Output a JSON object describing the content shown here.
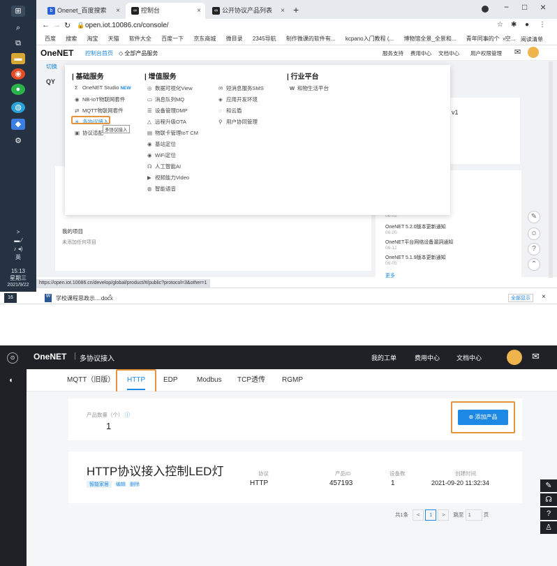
{
  "screenshot1": {
    "taskbar": {
      "time": "15:13",
      "weekday": "星期三",
      "date": "2021/9/22",
      "ime": "英",
      "notify_count": "16"
    },
    "tabs": [
      {
        "label": "Onenet_百度搜索",
        "close": "×"
      },
      {
        "label": "控制台",
        "close": "×"
      },
      {
        "label": "公开协议产品列表",
        "close": "×"
      }
    ],
    "new_tab": "+",
    "window_controls": {
      "minimize": "−",
      "maximize": "□",
      "close": "×"
    },
    "address": "open.iot.10086.cn/console/",
    "bookmarks": [
      "百度",
      "搜索",
      "淘宝",
      "天猫",
      "软件大全",
      "百度一下",
      "京东商城",
      "微目录",
      "2345导航",
      "制作微课的软件有...",
      "kcpano入门教程 (...",
      "博物馆全景_全景和...",
      "青年同事的个人空..."
    ],
    "bookmarks_more": "»",
    "reading_list": "阅读清单",
    "header": {
      "logo": "OneNET",
      "console_home": "控制台首页",
      "all_services": "全部产品服务",
      "nav": [
        "服务支持",
        "费用中心",
        "文档中心",
        "用户权限管理"
      ]
    },
    "mega_menu": {
      "columns": [
        {
          "title": "基础服务",
          "items": [
            {
              "icon": "Σ",
              "label": "OneNET Studio",
              "badge": "NEW"
            },
            {
              "icon": "◉",
              "label": "NB-IoT物联网套件"
            },
            {
              "icon": "⇄",
              "label": "MQTT物联网套件"
            },
            {
              "icon": "✳",
              "label": "多协议接入"
            },
            {
              "icon": "▣",
              "label": "协议适配"
            }
          ]
        },
        {
          "title": "增值服务",
          "items": [
            {
              "icon": "◎",
              "label": "数据可视化View"
            },
            {
              "icon": "▭",
              "label": "消息队列MQ"
            },
            {
              "icon": "☰",
              "label": "设备管理DMP"
            },
            {
              "icon": "△",
              "label": "远程升级OTA"
            },
            {
              "icon": "▤",
              "label": "物联卡管理IoT CM"
            },
            {
              "icon": "◉",
              "label": "基站定位"
            },
            {
              "icon": "◉",
              "label": "WiFi定位"
            },
            {
              "icon": "☊",
              "label": "人工智能AI"
            },
            {
              "icon": "▶",
              "label": "视频能力Video"
            },
            {
              "icon": "◍",
              "label": "智能语音"
            }
          ]
        },
        {
          "title": "",
          "items": [
            {
              "icon": "✉",
              "label": "短消息服务SMS"
            },
            {
              "icon": "◈",
              "label": "应用开发环境"
            },
            {
              "icon": "◌",
              "label": "和云盾"
            },
            {
              "icon": "⚲",
              "label": "用户协同管理"
            }
          ]
        },
        {
          "title": "行业平台",
          "items": [
            {
              "icon": "W",
              "label": "和物生活平台"
            }
          ]
        }
      ],
      "tooltip": "多协议接入"
    },
    "background": {
      "partial_text_1": "切换",
      "partial_text_2": "QY",
      "partial_text_3": "v1",
      "my_projects": "我的项目",
      "no_projects": "未添加任何项目",
      "news": [
        {
          "title": "",
          "date": "08-02"
        },
        {
          "title": "OneNET 5.2.0版本更新通知",
          "date": "08-20"
        },
        {
          "title": "OneNET平台网络设备漏洞通知",
          "date": "08-12"
        },
        {
          "title": "OneNET 5.1.9版本更新通知",
          "date": "08-05"
        }
      ],
      "more": "更多"
    },
    "status_url": "https://open.iot.10086.cn/develop/global/product/#/public?protocol=3&other=1",
    "download": {
      "file": "学校课程思政示....docx",
      "chevron": "^",
      "show_all": "全部显示",
      "close": "×"
    }
  },
  "screenshot2": {
    "logo": "OneNET",
    "section": "多协议接入",
    "top_nav": [
      "我的工单",
      "费用中心",
      "文档中心"
    ],
    "tabs": [
      "MQTT（旧版）",
      "HTTP",
      "EDP",
      "Modbus",
      "TCP透传",
      "RGMP"
    ],
    "active_tab": "HTTP",
    "summary": {
      "label": "产品数量（个）",
      "count": "1"
    },
    "add_button": "添加产品",
    "product": {
      "name": "HTTP协议接入控制LED灯",
      "actions": [
        "智能家居",
        "编辑",
        "删除"
      ],
      "columns": [
        {
          "label": "协议",
          "value": "HTTP"
        },
        {
          "label": "产品ID",
          "value": "457193"
        },
        {
          "label": "设备数",
          "value": "1"
        },
        {
          "label": "创建时间",
          "value": "2021-09-20 11:32:34"
        }
      ]
    },
    "pagination": {
      "total": "共1条",
      "prev": "<",
      "page": "1",
      "next": ">",
      "jump_label": "跳至",
      "jump_value": "1",
      "unit": "页"
    }
  },
  "colors": {
    "highlight": "#e3943e",
    "onenet_blue": "#1e88e5",
    "dark_bg": "#1f2127",
    "taskbar": "#243241"
  }
}
